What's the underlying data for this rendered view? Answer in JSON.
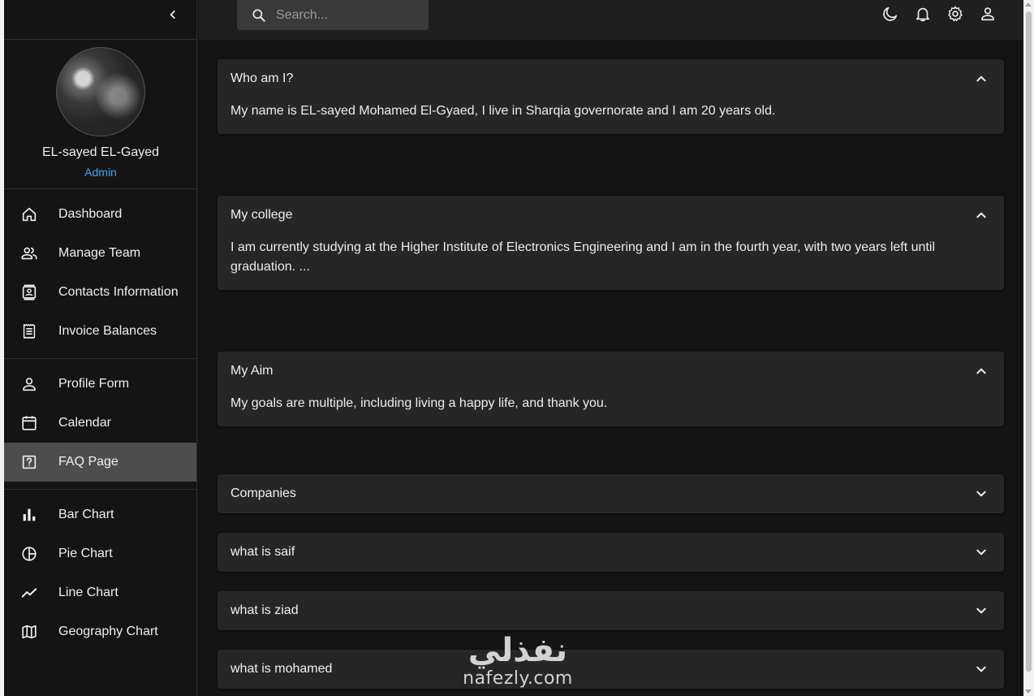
{
  "sidebar": {
    "profile": {
      "name": "EL-sayed EL-Gayed",
      "role": "Admin"
    },
    "groups": [
      [
        {
          "label": "Dashboard",
          "icon": "home-icon"
        },
        {
          "label": "Manage Team",
          "icon": "people-icon"
        },
        {
          "label": "Contacts Information",
          "icon": "contacts-icon"
        },
        {
          "label": "Invoice Balances",
          "icon": "receipt-icon"
        }
      ],
      [
        {
          "label": "Profile Form",
          "icon": "person-icon"
        },
        {
          "label": "Calendar",
          "icon": "calendar-icon"
        },
        {
          "label": "FAQ Page",
          "icon": "help-center-icon",
          "active": true
        }
      ],
      [
        {
          "label": "Bar Chart",
          "icon": "bar-chart-icon"
        },
        {
          "label": "Pie Chart",
          "icon": "pie-chart-icon"
        },
        {
          "label": "Line Chart",
          "icon": "timeline-icon"
        },
        {
          "label": "Geography Chart",
          "icon": "map-icon"
        }
      ]
    ]
  },
  "topbar": {
    "search_placeholder": "Search...",
    "icons": [
      "dark-mode-icon",
      "notifications-icon",
      "settings-icon",
      "person-icon"
    ]
  },
  "faq": [
    {
      "title": "Who am I?",
      "body": "My name is EL-sayed Mohamed El-Gyaed, I live in Sharqia governorate and I am 20 years old.",
      "expanded": true
    },
    {
      "title": "My college",
      "body": "I am currently studying at the Higher Institute of Electronics Engineering and I am in the fourth year, with two years left until graduation. ...",
      "expanded": true
    },
    {
      "title": "My Aim",
      "body": "My goals are multiple, including living a happy life, and thank you.",
      "expanded": true
    },
    {
      "title": "Companies",
      "expanded": false
    },
    {
      "title": "what is saif",
      "expanded": false
    },
    {
      "title": "what is ziad",
      "expanded": false
    },
    {
      "title": "what is mohamed",
      "expanded": false
    }
  ],
  "watermark": {
    "arabic": "نفذلي",
    "latin": "nafezly.com"
  },
  "colors": {
    "accent": "#3da9fc",
    "active_bg": "#4d4d4d",
    "card_bg": "#262626",
    "page_bg": "#141414"
  }
}
